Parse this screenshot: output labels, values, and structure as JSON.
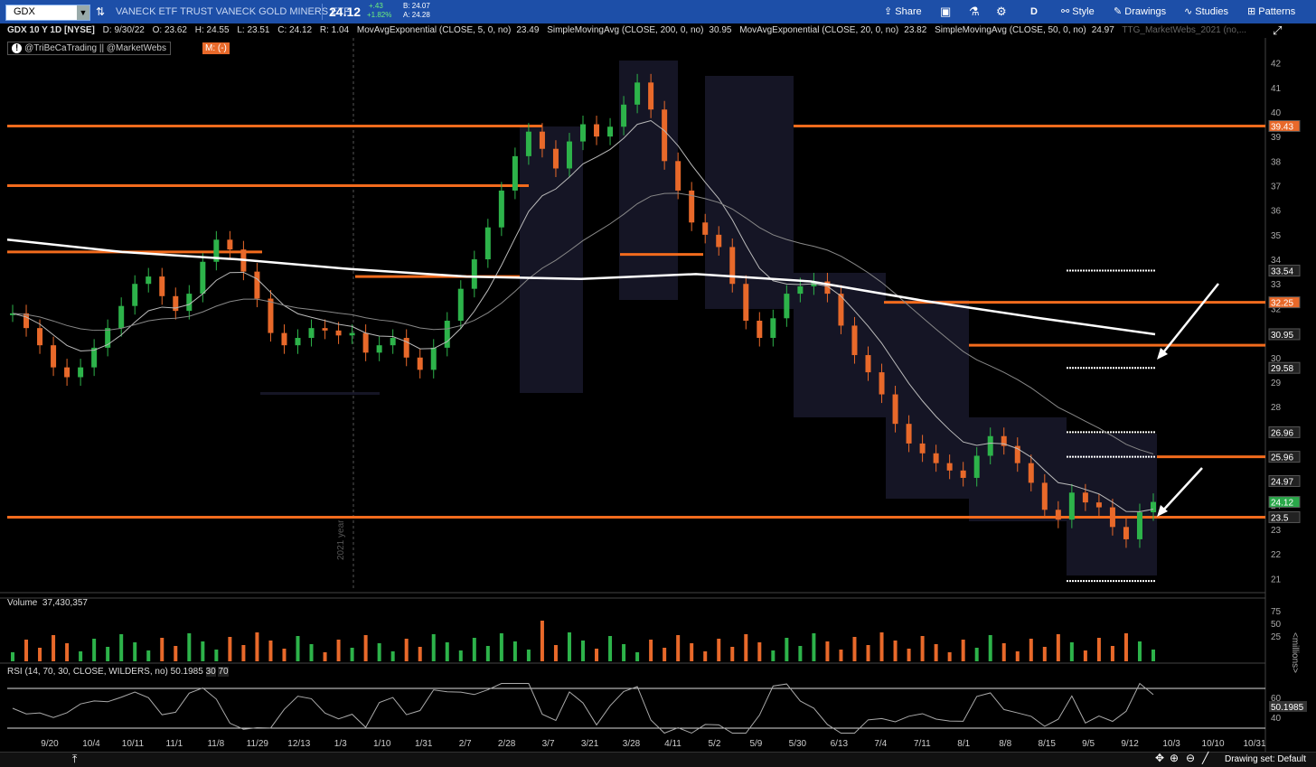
{
  "toolbar": {
    "symbol": "GDX",
    "description": "VANECK ETF TRUST VANECK GOLD MINERS ETF",
    "last": "24.12",
    "change": "+.43",
    "change_pct": "+1.82%",
    "bid": "B: 24.07",
    "ask": "A: 24.28",
    "share": "Share",
    "aggregation": "D",
    "style": "Style",
    "drawings": "Drawings",
    "studies": "Studies",
    "patterns": "Patterns"
  },
  "studies": {
    "header": "GDX 10 Y 1D [NYSE]",
    "ohlc": [
      "D: 9/30/22",
      "O: 23.62",
      "H: 24.55",
      "L: 23.51",
      "C: 24.12",
      "R: 1.04"
    ],
    "ma1": "MovAvgExponential (CLOSE, 5, 0, no)",
    "ma1_val": "23.49",
    "ma2": "SimpleMovingAvg (CLOSE, 200, 0, no)",
    "ma2_val": "30.95",
    "ma3": "MovAvgExponential (CLOSE, 20, 0, no)",
    "ma3_val": "23.82",
    "ma4": "SimpleMovingAvg (CLOSE, 50, 0, no)",
    "ma4_val": "24.97",
    "extra": "TTG_MarketWebs_2021 (no,..."
  },
  "watermark": "@TriBeCaTrading || @MarketWebs",
  "mode_badge": "M: (-)",
  "year_label": "2021 year",
  "price_axis": [
    "42",
    "41",
    "40",
    "39",
    "38",
    "37",
    "36",
    "35",
    "34",
    "33",
    "32",
    "31",
    "30",
    "29",
    "28",
    "27",
    "26",
    "25",
    "24",
    "23",
    "22",
    "21"
  ],
  "price_badges": [
    {
      "label": "39.43",
      "value": 39.43,
      "color": "#e8692a"
    },
    {
      "label": "33.54",
      "value": 33.54,
      "color": "#222"
    },
    {
      "label": "32.25",
      "value": 32.25,
      "color": "#e8692a"
    },
    {
      "label": "30.95",
      "value": 30.95,
      "color": "#222"
    },
    {
      "label": "29.58",
      "value": 29.58,
      "color": "#222"
    },
    {
      "label": "26.96",
      "value": 26.96,
      "color": "#222"
    },
    {
      "label": "25.96",
      "value": 25.96,
      "color": "#222"
    },
    {
      "label": "24.97",
      "value": 24.97,
      "color": "#222"
    },
    {
      "label": "24.12",
      "value": 24.12,
      "color": "#2aa84a"
    },
    {
      "label": "23.5",
      "value": 23.5,
      "color": "#222"
    }
  ],
  "volume": {
    "label": "Volume",
    "value": "37,430,357",
    "axis": [
      "75",
      "50",
      "25"
    ],
    "unit": "<millions>"
  },
  "rsi": {
    "label": "RSI (14, 70, 30, CLOSE, WILDERS, no)",
    "value": "50.1985",
    "ob": "30",
    "os": "70",
    "axis": [
      "60",
      "40"
    ],
    "badge": "50.1985"
  },
  "date_axis": [
    "9/20",
    "10/4",
    "10/11",
    "11/1",
    "11/8",
    "11/29",
    "12/13",
    "1/3",
    "1/10",
    "1/31",
    "2/7",
    "2/28",
    "3/7",
    "3/21",
    "3/28",
    "4/11",
    "5/2",
    "5/9",
    "5/30",
    "6/13",
    "7/4",
    "7/11",
    "8/1",
    "8/8",
    "8/15",
    "9/5",
    "9/12",
    "10/3",
    "10/10",
    "10/31"
  ],
  "status": {
    "drawing_set": "Drawing set: Default"
  },
  "colors": {
    "up": "#2db34a",
    "down": "#e8692a",
    "orange_level": "#f26b1d",
    "sma200": "#ffffff",
    "toolbar": "#1d4fa8"
  },
  "chart_data": {
    "type": "candlestick",
    "symbol": "GDX",
    "ylim": [
      20.5,
      42.5
    ],
    "key_levels": [
      39.43,
      37.0,
      34.3,
      33.3,
      32.25,
      30.5,
      25.96,
      23.5
    ],
    "sma200_path": [
      [
        0,
        34.8
      ],
      [
        0.1,
        34.3
      ],
      [
        0.2,
        34.0
      ],
      [
        0.3,
        33.6
      ],
      [
        0.4,
        33.3
      ],
      [
        0.5,
        33.2
      ],
      [
        0.6,
        33.4
      ],
      [
        0.7,
        33.1
      ],
      [
        0.8,
        32.3
      ],
      [
        0.9,
        31.6
      ],
      [
        1.0,
        30.95
      ]
    ],
    "closes": [
      31.8,
      31.2,
      30.5,
      29.6,
      29.2,
      29.6,
      30.4,
      31.2,
      32.1,
      33.0,
      33.3,
      32.5,
      31.9,
      32.6,
      33.9,
      34.8,
      34.4,
      33.5,
      32.4,
      31.0,
      30.5,
      30.8,
      31.2,
      31.1,
      30.9,
      31.0,
      30.2,
      30.5,
      30.8,
      30.0,
      29.5,
      30.4,
      31.5,
      32.8,
      34.0,
      35.3,
      36.8,
      38.2,
      39.2,
      38.5,
      37.7,
      38.8,
      39.5,
      39.0,
      39.4,
      40.3,
      41.2,
      40.1,
      38.0,
      36.8,
      35.5,
      35.0,
      34.5,
      33.0,
      31.5,
      30.8,
      31.6,
      32.6,
      32.9,
      33.1,
      32.6,
      31.3,
      30.1,
      29.4,
      28.5,
      27.3,
      26.5,
      26.1,
      25.7,
      25.4,
      25.1,
      26.0,
      26.8,
      26.4,
      25.7,
      24.9,
      23.8,
      23.4,
      24.5,
      24.1,
      23.9,
      23.1,
      22.6,
      23.7,
      24.12
    ]
  }
}
